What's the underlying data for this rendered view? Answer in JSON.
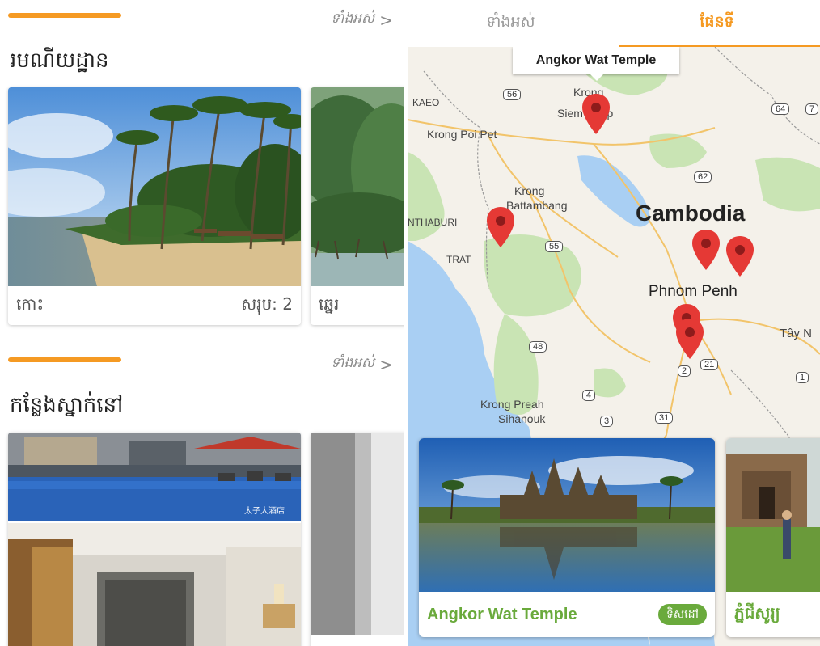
{
  "left": {
    "sections": [
      {
        "title": "រមណីយដ្ឋាន",
        "see_all": "ទាំងអស់",
        "cards": [
          {
            "label": "កោះ",
            "count": "សរុប: 2"
          },
          {
            "label": "ឆ្នេរ",
            "count": ""
          }
        ]
      },
      {
        "title": "កន្លែងស្នាក់នៅ",
        "see_all": "ទាំងអស់",
        "hotel_watermark": "太子大酒店"
      }
    ],
    "chevron": ">"
  },
  "right": {
    "tabs": [
      "ទាំងអស់",
      "ផែនទី"
    ],
    "active_tab": 1,
    "tooltip": "Angkor Wat Temple",
    "map": {
      "country": "Cambodia",
      "labels": [
        "Krong Siem Reap",
        "Krong Poi Pet",
        "Krong Battambang",
        "Phnom Penh",
        "Krong Preah Sihanouk",
        "TRAT",
        "NTHABURI",
        "KAEO",
        "Tây N"
      ],
      "label_lines": {
        "siem_reap_1": "Krong",
        "siem_reap_2": "Siem Reap",
        "battambang_1": "Krong",
        "battambang_2": "Battambang",
        "sihanouk_1": "Krong Preah",
        "sihanouk_2": "Sihanouk"
      },
      "road_numbers": [
        "56",
        "64",
        "7",
        "62",
        "55",
        "48",
        "21",
        "2",
        "1",
        "4",
        "3",
        "31"
      ]
    },
    "places": [
      {
        "name": "Angkor Wat Temple",
        "button": "ទិសដៅ"
      },
      {
        "name": "ភ្នំជីសូរ្យ"
      }
    ]
  },
  "colors": {
    "accent": "#f59a23",
    "green": "#6aaa3c",
    "marker": "#e53935"
  }
}
